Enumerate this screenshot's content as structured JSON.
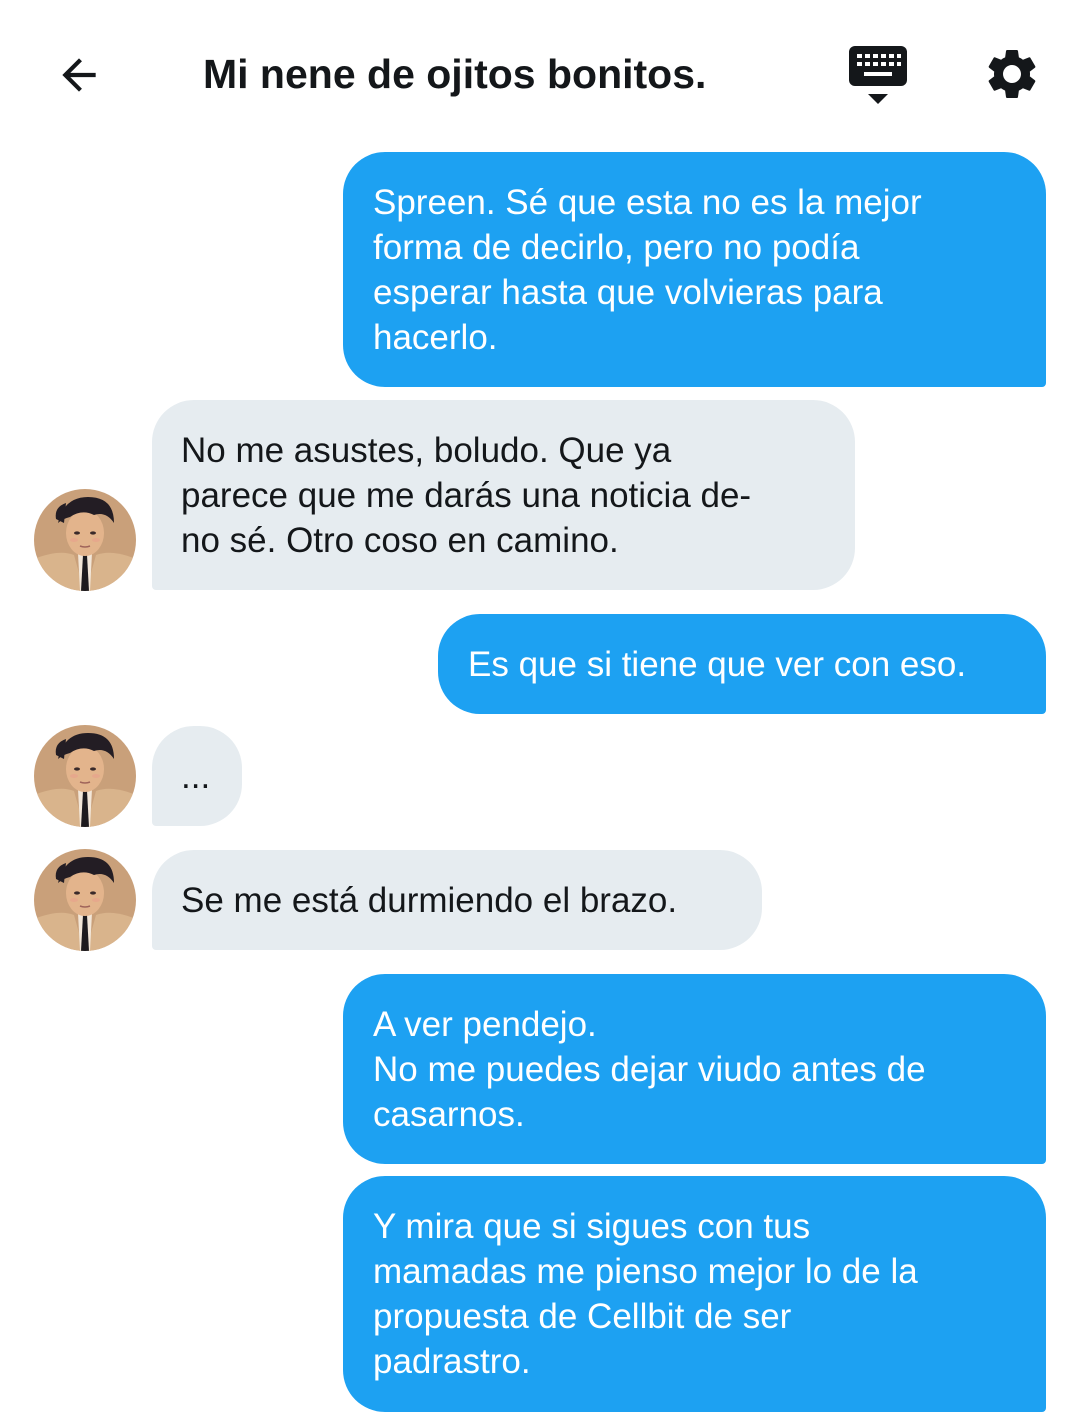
{
  "header": {
    "title": "Mi nene de ojitos bonitos.",
    "back_icon": "arrow-left-icon",
    "keyboard_icon": "keyboard-icon",
    "settings_icon": "gear-icon"
  },
  "colors": {
    "sent_bubble": "#1da1f2",
    "received_bubble": "#e6ecf0",
    "text_dark": "#14171a"
  },
  "messages": [
    {
      "direction": "sent",
      "text": "Spreen. Sé que esta no es la mejor\nforma de decirlo, pero no podía\nesperar hasta que volvieras para\nhacerlo."
    },
    {
      "direction": "received",
      "text": "No me asustes, boludo. Que ya\nparece que me darás una noticia de-\nno sé. Otro coso en camino."
    },
    {
      "direction": "sent",
      "text": "Es que si tiene que ver con eso."
    },
    {
      "direction": "received",
      "text": "..."
    },
    {
      "direction": "received",
      "text": "Se me está durmiendo el brazo."
    },
    {
      "direction": "sent",
      "text": "A ver pendejo.\nNo me puedes dejar viudo antes de\ncasarnos."
    },
    {
      "direction": "sent",
      "text": "Y mira que si sigues con tus\nmamadas me pienso mejor lo de la\npropuesta de Cellbit de ser\npadrastro."
    }
  ]
}
